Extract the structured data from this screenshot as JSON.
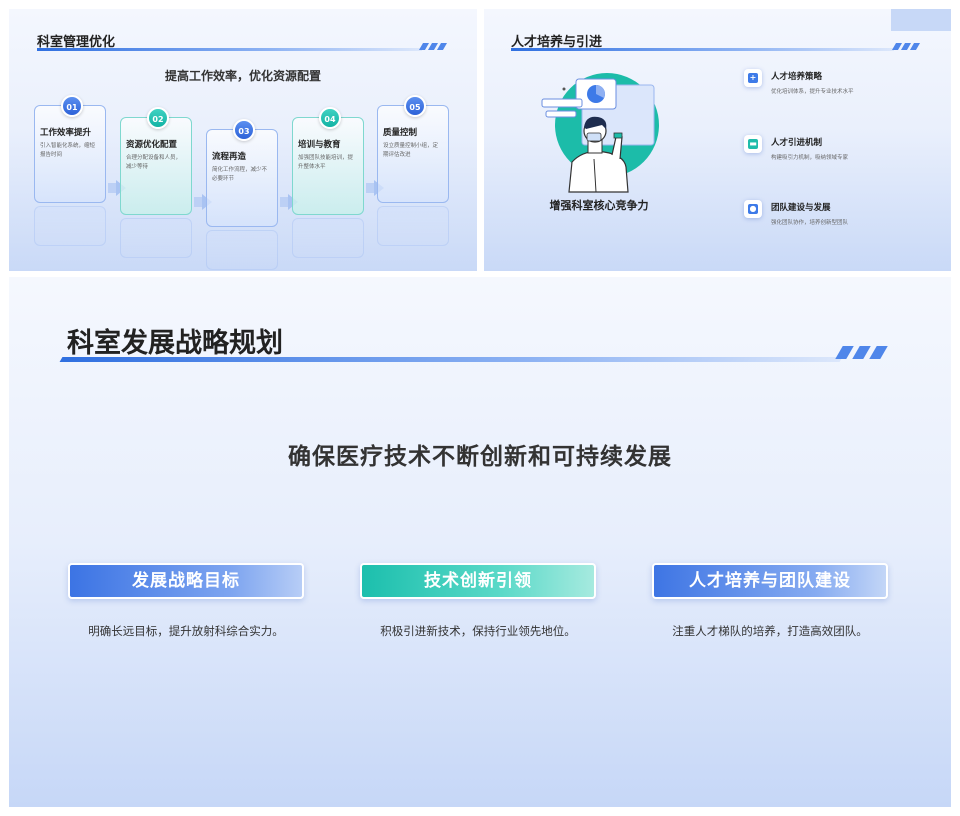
{
  "slide1": {
    "title": "科室管理优化",
    "subtitle": "提高工作效率，优化资源配置",
    "steps": [
      {
        "num": "01",
        "title": "工作效率提升",
        "desc": "引入智能化系统，缩短报告时间"
      },
      {
        "num": "02",
        "title": "资源优化配置",
        "desc": "合理分配设备和人员，减少等待"
      },
      {
        "num": "03",
        "title": "流程再造",
        "desc": "简化工作流程，减少不必要环节"
      },
      {
        "num": "04",
        "title": "培训与教育",
        "desc": "加强团队技能培训，提升整体水平"
      },
      {
        "num": "05",
        "title": "质量控制",
        "desc": "设立质量控制小组，定期评估改进"
      }
    ]
  },
  "slide2": {
    "title": "人才培养与引进",
    "caption": "增强科室核心竞争力",
    "items": [
      {
        "title": "人才培养策略",
        "desc": "优化培训体系，提升专业技术水平"
      },
      {
        "title": "人才引进机制",
        "desc": "构建吸引力机制，吸纳领域专家"
      },
      {
        "title": "团队建设与发展",
        "desc": "强化团队协作，培养创新型团队"
      }
    ]
  },
  "slide3": {
    "title": "科室发展战略规划",
    "headline": "确保医疗技术不断创新和可持续发展",
    "pillars": [
      {
        "label": "发展战略目标",
        "desc": "明确长远目标，提升放射科综合实力。"
      },
      {
        "label": "技术创新引领",
        "desc": "积极引进新技术，保持行业领先地位。"
      },
      {
        "label": "人才培养与团队建设",
        "desc": "注重人才梯队的培养，打造高效团队。"
      }
    ]
  }
}
